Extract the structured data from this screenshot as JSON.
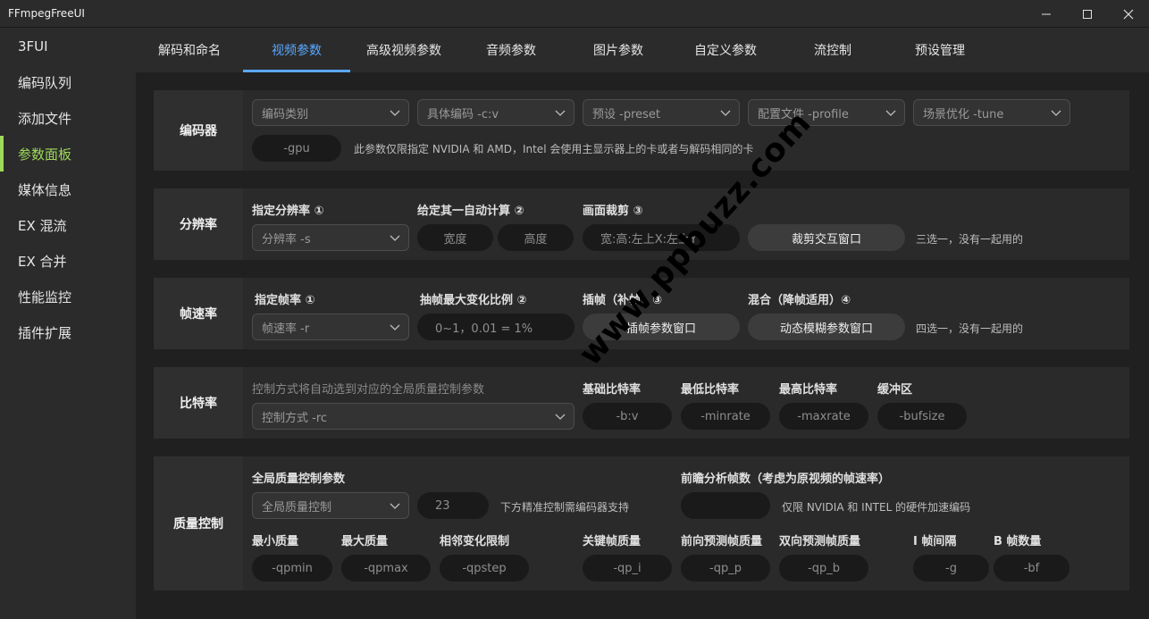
{
  "window": {
    "title": "FFmpegFreeUI"
  },
  "sidebar": {
    "items": [
      {
        "label": "3FUI"
      },
      {
        "label": "编码队列"
      },
      {
        "label": "添加文件"
      },
      {
        "label": "参数面板"
      },
      {
        "label": "媒体信息"
      },
      {
        "label": "EX 混流"
      },
      {
        "label": "EX 合并"
      },
      {
        "label": "性能监控"
      },
      {
        "label": "插件扩展"
      }
    ],
    "active_index": 3
  },
  "tabs": [
    {
      "label": "解码和命名"
    },
    {
      "label": "视频参数"
    },
    {
      "label": "高级视频参数"
    },
    {
      "label": "音频参数"
    },
    {
      "label": "图片参数"
    },
    {
      "label": "自定义参数"
    },
    {
      "label": "流控制"
    },
    {
      "label": "预设管理"
    }
  ],
  "encoder": {
    "label": "编码器",
    "category_placeholder": "编码类别",
    "codec_placeholder": "具体编码 -c:v",
    "preset_placeholder": "预设 -preset",
    "profile_placeholder": "配置文件 -profile",
    "tune_placeholder": "场景优化 -tune",
    "gpu_placeholder": "-gpu",
    "gpu_note": "此参数仅限指定 NVIDIA 和 AMD，Intel 会使用主显示器上的卡或者与解码相同的卡"
  },
  "resolution": {
    "label": "分辨率",
    "specify_label": "指定分辨率 ①",
    "specify_placeholder": "分辨率 -s",
    "auto_label": "给定其一自动计算 ②",
    "width_placeholder": "宽度",
    "height_placeholder": "高度",
    "crop_label": "画面裁剪 ③",
    "crop_placeholder": "宽:高:左上X:左上Y",
    "crop_button": "裁剪交互窗口",
    "note": "三选一，没有一起用的"
  },
  "framerate": {
    "label": "帧速率",
    "specify_label": "指定帧率 ①",
    "specify_placeholder": "帧速率 -r",
    "max_ratio_label": "抽帧最大变化比例 ②",
    "max_ratio_placeholder": "0~1，0.01 = 1%",
    "interp_label": "插帧（补帧）③",
    "interp_button": "插帧参数窗口",
    "blend_label": "混合（降帧适用）④",
    "blend_button": "动态模糊参数窗口",
    "note": "四选一，没有一起用的"
  },
  "bitrate": {
    "label": "比特率",
    "mode_note": "控制方式将自动选到对应的全局质量控制参数",
    "mode_placeholder": "控制方式 -rc",
    "base_label": "基础比特率",
    "base_placeholder": "-b:v",
    "min_label": "最低比特率",
    "min_placeholder": "-minrate",
    "max_label": "最高比特率",
    "max_placeholder": "-maxrate",
    "buf_label": "缓冲区",
    "buf_placeholder": "-bufsize"
  },
  "quality": {
    "label": "质量控制",
    "global_label": "全局质量控制参数",
    "global_placeholder": "全局质量控制",
    "global_value": "23",
    "global_note": "下方精准控制需编码器支持",
    "lookahead_label": "前瞻分析帧数（考虑为原视频的帧速率）",
    "lookahead_note": "仅限 NVIDIA 和 INTEL 的硬件加速编码",
    "qpmin_label": "最小质量",
    "qpmin_placeholder": "-qpmin",
    "qpmax_label": "最大质量",
    "qpmax_placeholder": "-qpmax",
    "qpstep_label": "相邻变化限制",
    "qpstep_placeholder": "-qpstep",
    "qpi_label": "关键帧质量",
    "qpi_placeholder": "-qp_i",
    "qpp_label": "前向预测帧质量",
    "qpp_placeholder": "-qp_p",
    "qpb_label": "双向预测帧质量",
    "qpb_placeholder": "-qp_b",
    "g_label": "I 帧间隔",
    "g_placeholder": "-g",
    "bf_label": "B 帧数量",
    "bf_placeholder": "-bf"
  },
  "watermark": "www.ppbuzz.com",
  "colors": {
    "accent_green": "#9fd95a",
    "accent_blue": "#5aa8ff"
  }
}
